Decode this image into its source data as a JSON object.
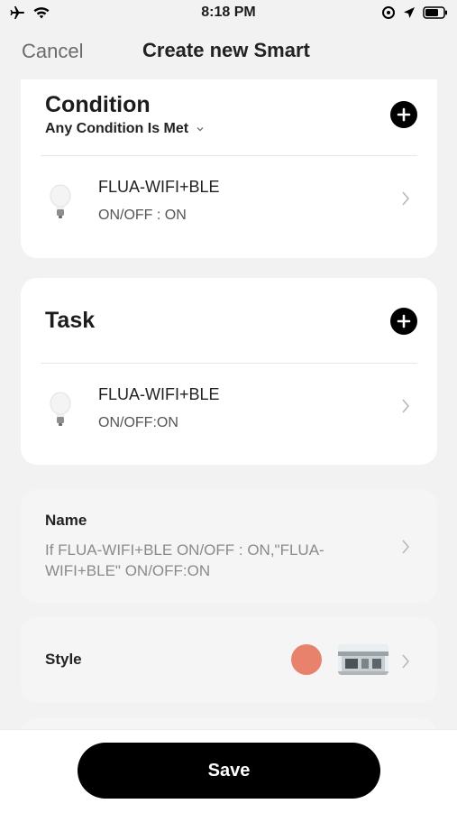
{
  "status_bar": {
    "time": "8:18 PM",
    "icons": [
      "airplane-icon",
      "wifi-icon",
      "location-lock-icon",
      "location-arrow-icon",
      "battery-icon"
    ]
  },
  "nav": {
    "cancel_label": "Cancel",
    "title": "Create new Smart"
  },
  "condition": {
    "title": "Condition",
    "mode": "Any Condition Is Met",
    "items": [
      {
        "device": "FLUA-WIFI+BLE",
        "value": "ON/OFF : ON"
      }
    ]
  },
  "task": {
    "title": "Task",
    "items": [
      {
        "device": "FLUA-WIFI+BLE",
        "value": "ON/OFF:ON"
      }
    ]
  },
  "name_section": {
    "label": "Name",
    "value": "If FLUA-WIFI+BLE ON/OFF : ON,\"FLUA-WIFI+BLE\" ON/OFF:ON"
  },
  "style_section": {
    "label": "Style",
    "color": "#e8826c"
  },
  "footer": {
    "save_label": "Save"
  },
  "colors": {
    "accent": "#000000",
    "background": "#f2f2f2",
    "card": "#ffffff"
  }
}
